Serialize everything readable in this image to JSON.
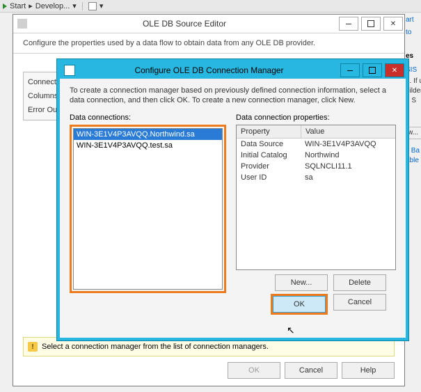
{
  "toolbar": {
    "start": "Start",
    "dev": "Develop..."
  },
  "source_editor": {
    "title": "OLE DB Source Editor",
    "description": "Configure the properties used by a data flow to obtain data from any OLE DB provider.",
    "tabs": {
      "connection": "Connectio",
      "columns": "Columns",
      "error": "Error Outp"
    },
    "warning": "Select a connection manager from the list of connection managers.",
    "buttons": {
      "ok": "OK",
      "cancel": "Cancel",
      "help": "Help"
    }
  },
  "config_mgr": {
    "title": "Configure OLE DB Connection Manager",
    "description": "To create a connection manager based on previously defined connection information, select a data connection, and then click OK. To create a new connection manager, click New.",
    "left_label": "Data connections:",
    "right_label": "Data connection properties:",
    "connections": {
      "0": "WIN-3E1V4P3AVQQ.Northwind.sa",
      "1": "WIN-3E1V4P3AVQQ.test.sa"
    },
    "prop_header": {
      "c1": "Property",
      "c2": "Value"
    },
    "props": {
      "0": {
        "k": "Data Source",
        "v": "WIN-3E1V4P3AVQQ"
      },
      "1": {
        "k": "Initial Catalog",
        "v": "Northwind"
      },
      "2": {
        "k": "Provider",
        "v": "SQLNCLI11.1"
      },
      "3": {
        "k": "User ID",
        "v": "sa"
      }
    },
    "buttons": {
      "new": "New...",
      "delete": "Delete",
      "ok": "OK",
      "cancel": "Cancel"
    }
  },
  "fragments": {
    "a": "art",
    "b": "to",
    "c": "es",
    "d": "SIS",
    "e": "d. If using",
    "f": "uilder.",
    "g": "n S",
    "h": "w...",
    "i": "y Ba",
    "j": "able"
  }
}
